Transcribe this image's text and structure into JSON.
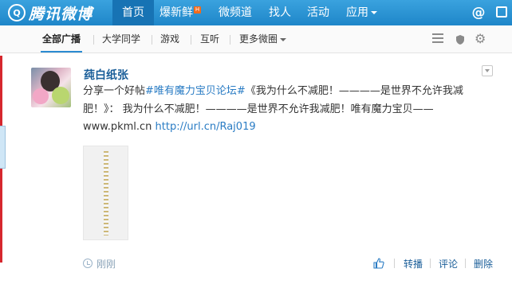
{
  "app": {
    "logo_text": "腾讯微博",
    "logo_glyph": "Q"
  },
  "topnav": {
    "items": [
      {
        "label": "首页"
      },
      {
        "label": "爆新鲜",
        "badge": "H"
      },
      {
        "label": "微频道"
      },
      {
        "label": "找人"
      },
      {
        "label": "活动"
      },
      {
        "label": "应用"
      }
    ],
    "at_icon": "@"
  },
  "subnav": {
    "items": [
      {
        "label": "全部广播"
      },
      {
        "label": "大学同学"
      },
      {
        "label": "游戏"
      },
      {
        "label": "互听"
      },
      {
        "label": "更多微圈"
      }
    ],
    "icons": [
      "list-icon",
      "shield-icon",
      "gear-icon"
    ],
    "gear_glyph": "⚙"
  },
  "post": {
    "author": "莼白纸张",
    "text_prefix": "分享一个好帖",
    "hashtag": "#唯有魔力宝贝论坛#",
    "text_body": "《我为什么不减肥！————是世界不允许我减肥！》： 我为什么不减肥！————是世界不允许我减肥！唯有魔力宝贝——www.pkml.cn ",
    "link": "http://url.cn/Raj019",
    "timestamp": "刚刚",
    "actions": {
      "repost": "转播",
      "comment": "评论",
      "delete": "删除"
    }
  },
  "colors": {
    "nav_blue": "#1e86c9",
    "link_blue": "#2a7cc4",
    "name_blue": "#1a5e99"
  }
}
